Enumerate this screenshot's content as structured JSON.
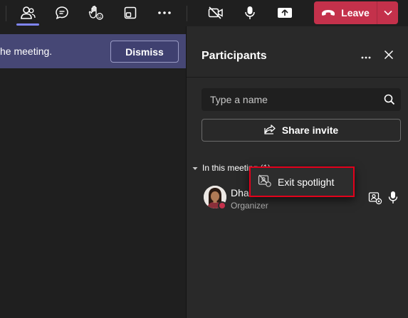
{
  "toolbar": {
    "buttons": [
      {
        "icon": "people-icon",
        "active": true
      },
      {
        "icon": "chat-icon"
      },
      {
        "icon": "raise-hand-icon"
      },
      {
        "icon": "view-icon"
      },
      {
        "icon": "more-icon"
      },
      {
        "icon": "camera-off-icon"
      },
      {
        "icon": "mic-icon"
      },
      {
        "icon": "share-screen-icon"
      }
    ],
    "leave_label": "Leave",
    "accent_color": "#7f85f5",
    "leave_color": "#c4314b"
  },
  "banner": {
    "text": "he meeting.",
    "dismiss_label": "Dismiss",
    "color": "#464775"
  },
  "panel": {
    "title": "Participants",
    "search_placeholder": "Type a name",
    "share_invite_label": "Share invite",
    "section_label": "In this meeting (1)",
    "participants": [
      {
        "name": "Dha",
        "role": "Organizer",
        "status_color": "#c4314b"
      }
    ]
  },
  "context_menu": {
    "items": [
      {
        "label": "Exit spotlight",
        "icon": "exit-spotlight-icon"
      }
    ],
    "highlight_color": "#e3001b"
  }
}
